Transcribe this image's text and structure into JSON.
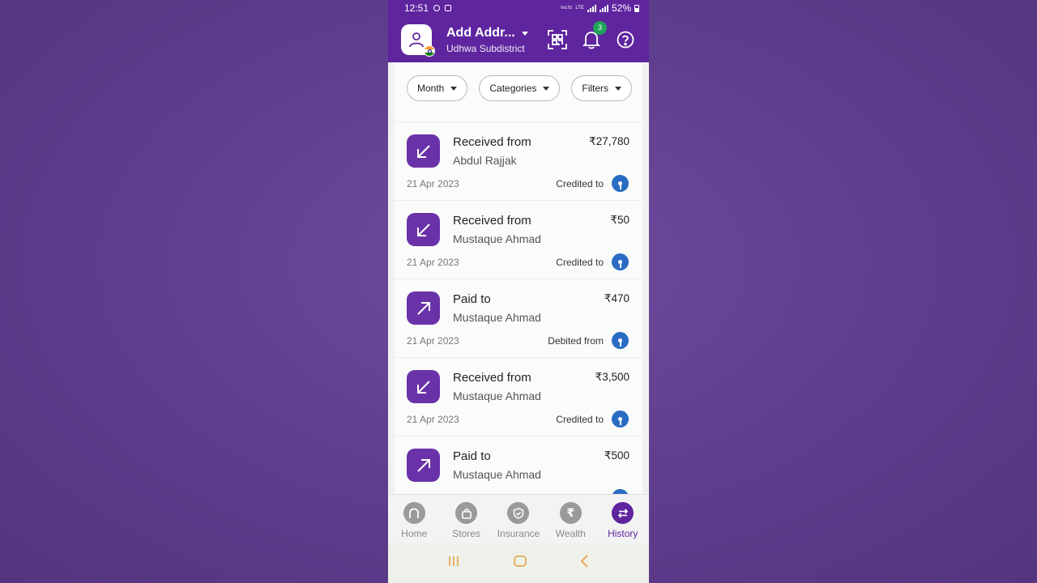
{
  "status_bar": {
    "time": "12:51",
    "network_label_top": "VoLTE",
    "network_label_bottom": "LTE",
    "battery": "52%"
  },
  "header": {
    "title": "Add Addr...",
    "subtitle": "Udhwa Subdistrict",
    "notification_count": "3",
    "icons": [
      "profile-icon",
      "qr-scan-icon",
      "bell-icon",
      "help-icon"
    ]
  },
  "filters": [
    {
      "label": "Month"
    },
    {
      "label": "Categories"
    },
    {
      "label": "Filters"
    }
  ],
  "transactions": [
    {
      "direction": "in",
      "title": "Received from",
      "name": "Abdul Rajjak",
      "amount": "₹27,780",
      "date": "21 Apr 2023",
      "status": "Credited to"
    },
    {
      "direction": "in",
      "title": "Received from",
      "name": "Mustaque Ahmad",
      "amount": "₹50",
      "date": "21 Apr 2023",
      "status": "Credited to"
    },
    {
      "direction": "out",
      "title": "Paid to",
      "name": "Mustaque Ahmad",
      "amount": "₹470",
      "date": "21 Apr 2023",
      "status": "Debited from"
    },
    {
      "direction": "in",
      "title": "Received from",
      "name": "Mustaque Ahmad",
      "amount": "₹3,500",
      "date": "21 Apr 2023",
      "status": "Credited to"
    },
    {
      "direction": "out",
      "title": "Paid to",
      "name": "Mustaque Ahmad",
      "amount": "₹500",
      "date": "",
      "status": ""
    }
  ],
  "bottom_nav": [
    {
      "label": "Home",
      "icon": "home-icon",
      "active": false
    },
    {
      "label": "Stores",
      "icon": "bag-icon",
      "active": false
    },
    {
      "label": "Insurance",
      "icon": "shield-icon",
      "active": false
    },
    {
      "label": "Wealth",
      "icon": "rupee-icon",
      "active": false,
      "glyph": "₹"
    },
    {
      "label": "History",
      "icon": "swap-arrows-icon",
      "active": true
    }
  ],
  "colors": {
    "brand": "#5f259f",
    "txn_icon": "#6a32a8",
    "bank_logo": "#2a6cc4",
    "badge": "#1fa45a",
    "system_nav": "#e8a958"
  }
}
